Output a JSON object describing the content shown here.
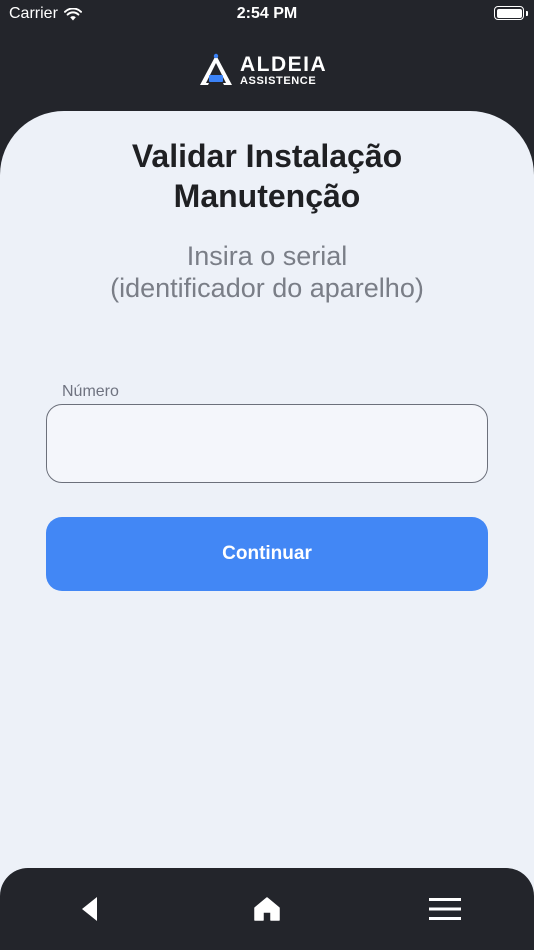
{
  "status_bar": {
    "carrier": "Carrier",
    "time": "2:54 PM"
  },
  "logo": {
    "name": "ALDEIA",
    "tagline": "ASSISTENCE"
  },
  "page": {
    "title_line1": "Validar Instalação",
    "title_line2": "Manutenção",
    "subtitle_line1": "Insira o serial",
    "subtitle_line2": "(identificador do aparelho)"
  },
  "form": {
    "number_label": "Número",
    "number_value": "",
    "continue_label": "Continuar"
  },
  "nav": {
    "icons": [
      "back-icon",
      "home-icon",
      "menu-icon"
    ]
  },
  "colors": {
    "background": "#23252b",
    "card": "#edf1f8",
    "accent": "#4287f5",
    "logo_accent": "#3b82f6"
  }
}
